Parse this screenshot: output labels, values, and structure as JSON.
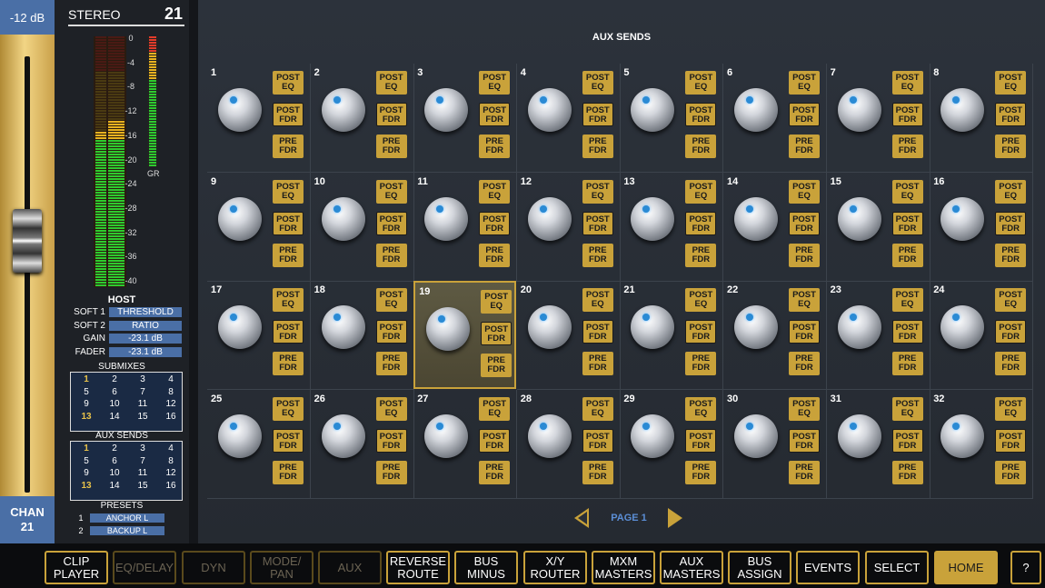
{
  "fader": {
    "db_label": "-12 dB",
    "chan_label": "CHAN",
    "chan_number": "21"
  },
  "channel": {
    "name": "STEREO",
    "number": "21"
  },
  "meter": {
    "scale": [
      "0",
      "-4",
      "-8",
      "-12",
      "-16",
      "-20",
      "-24",
      "-28",
      "-32",
      "-36",
      "-40"
    ],
    "gr_label": "GR",
    "left_level": 0.62,
    "right_level": 0.66,
    "gr_level": 1.0
  },
  "host": {
    "title": "HOST",
    "rows": [
      {
        "label": "SOFT 1",
        "value": "THRESHOLD"
      },
      {
        "label": "SOFT 2",
        "value": "RATIO"
      },
      {
        "label": "GAIN",
        "value": "-23.1 dB"
      },
      {
        "label": "FADER",
        "value": "-23.1 dB"
      }
    ]
  },
  "submixes": {
    "title": "SUBMIXES",
    "cells": [
      "1",
      "2",
      "3",
      "4",
      "5",
      "6",
      "7",
      "8",
      "9",
      "10",
      "11",
      "12",
      "13",
      "14",
      "15",
      "16"
    ],
    "highlight": [
      "1",
      "13"
    ]
  },
  "aux_grid": {
    "title": "AUX SENDS",
    "cells": [
      "1",
      "2",
      "3",
      "4",
      "5",
      "6",
      "7",
      "8",
      "9",
      "10",
      "11",
      "12",
      "13",
      "14",
      "15",
      "16"
    ],
    "highlight": [
      "1",
      "13"
    ]
  },
  "presets": {
    "title": "PRESETS",
    "items": [
      {
        "num": "1",
        "name": "ANCHOR L"
      },
      {
        "num": "2",
        "name": "BACKUP L"
      }
    ]
  },
  "main": {
    "title": "AUX SENDS",
    "selected_cell": "19",
    "cells": [
      "1",
      "2",
      "3",
      "4",
      "5",
      "6",
      "7",
      "8",
      "9",
      "10",
      "11",
      "12",
      "13",
      "14",
      "15",
      "16",
      "17",
      "18",
      "19",
      "20",
      "21",
      "22",
      "23",
      "24",
      "25",
      "26",
      "27",
      "28",
      "29",
      "30",
      "31",
      "32"
    ],
    "buttons": [
      "POST EQ",
      "POST FDR",
      "PRE FDR"
    ],
    "page_label": "PAGE 1"
  },
  "bottom": [
    {
      "label": "CLIP PLAYER",
      "state": "normal"
    },
    {
      "label": "EQ/DELAY",
      "state": "dim"
    },
    {
      "label": "DYN",
      "state": "dim"
    },
    {
      "label": "MODE/ PAN",
      "state": "dim"
    },
    {
      "label": "AUX",
      "state": "dim"
    },
    {
      "label": "REVERSE ROUTE",
      "state": "normal"
    },
    {
      "label": "BUS MINUS",
      "state": "normal"
    },
    {
      "label": "X/Y ROUTER",
      "state": "normal"
    },
    {
      "label": "MXM MASTERS",
      "state": "normal"
    },
    {
      "label": "AUX MASTERS",
      "state": "normal"
    },
    {
      "label": "BUS ASSIGN",
      "state": "normal"
    },
    {
      "label": "EVENTS",
      "state": "normal"
    },
    {
      "label": "SELECT",
      "state": "normal"
    },
    {
      "label": "HOME",
      "state": "active"
    },
    {
      "label": "?",
      "state": "normal"
    }
  ],
  "colors": {
    "accent": "#c9a23a",
    "panel_blue": "#4a6fa6",
    "link_blue": "#5b8ed6"
  }
}
